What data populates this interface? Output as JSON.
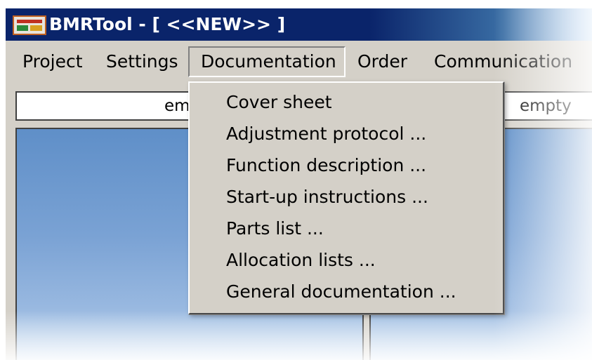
{
  "window": {
    "title": "BMRTool  - [ <<NEW>> ]",
    "icon": "app-icon"
  },
  "menubar": {
    "items": [
      {
        "label": "Project"
      },
      {
        "label": "Settings"
      },
      {
        "label": "Documentation",
        "open": true
      },
      {
        "label": "Order"
      },
      {
        "label": "Communication"
      }
    ]
  },
  "fields": {
    "left_value": "em",
    "right_value": "empty"
  },
  "dropdown": {
    "items": [
      {
        "label": "Cover sheet"
      },
      {
        "label": "Adjustment protocol ..."
      },
      {
        "label": "Function description ..."
      },
      {
        "label": "Start-up instructions ..."
      },
      {
        "label": "Parts list ..."
      },
      {
        "label": "Allocation lists ..."
      },
      {
        "label": "General documentation ..."
      }
    ]
  },
  "colors": {
    "titlebar": "#0a246a",
    "face": "#d4d0c8",
    "pane": "#7aa2d4"
  }
}
